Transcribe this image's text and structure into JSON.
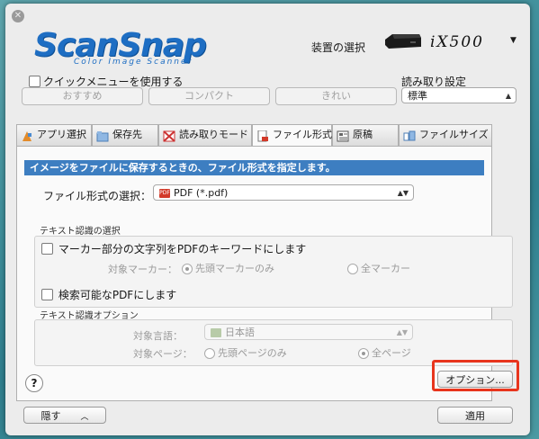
{
  "header": {
    "logo_main": "ScanSnap",
    "logo_sub": "Color Image Scanner",
    "device_label": "装置の選択",
    "device_model": "iX500"
  },
  "quick_menu": {
    "label": "クイックメニューを使用する",
    "checked": false
  },
  "presets": {
    "recommended": "おすすめ",
    "compact": "コンパクト",
    "clean": "きれい"
  },
  "read_settings": {
    "label": "読み取り設定",
    "selected": "標準"
  },
  "tabs": [
    {
      "label": "アプリ選択",
      "icon": "app-select-icon"
    },
    {
      "label": "保存先",
      "icon": "folder-icon"
    },
    {
      "label": "読み取りモード",
      "icon": "scan-mode-icon"
    },
    {
      "label": "ファイル形式",
      "icon": "file-format-icon",
      "active": true
    },
    {
      "label": "原稿",
      "icon": "document-icon"
    },
    {
      "label": "ファイルサイズ",
      "icon": "file-size-icon"
    }
  ],
  "panel": {
    "header": "イメージをファイルに保存するときの、ファイル形式を指定します。",
    "format_label": "ファイル形式の選択：",
    "format_value": "PDF (*.pdf)",
    "format_icon_text": "PDF",
    "text_recog_title": "テキスト認識の選択",
    "marker_label": "マーカー部分の文字列をPDFのキーワードにします",
    "marker_checked": false,
    "target_marker_label": "対象マーカー：",
    "first_marker_only": "先頭マーカーのみ",
    "all_markers": "全マーカー",
    "searchable_label": "検索可能なPDFにします",
    "searchable_checked": false,
    "ocr_options_title": "テキスト認識オプション",
    "language_label": "対象言語：",
    "language_value": "日本語",
    "pages_label": "対象ページ：",
    "first_page_only": "先頭ページのみ",
    "all_pages": "全ページ"
  },
  "buttons": {
    "help": "?",
    "options": "オプション...",
    "hide": "隠す",
    "apply": "適用"
  },
  "colors": {
    "header_bg": "#3d7ec1",
    "highlight": "#e8351d",
    "logo": "#1e6ec3"
  }
}
